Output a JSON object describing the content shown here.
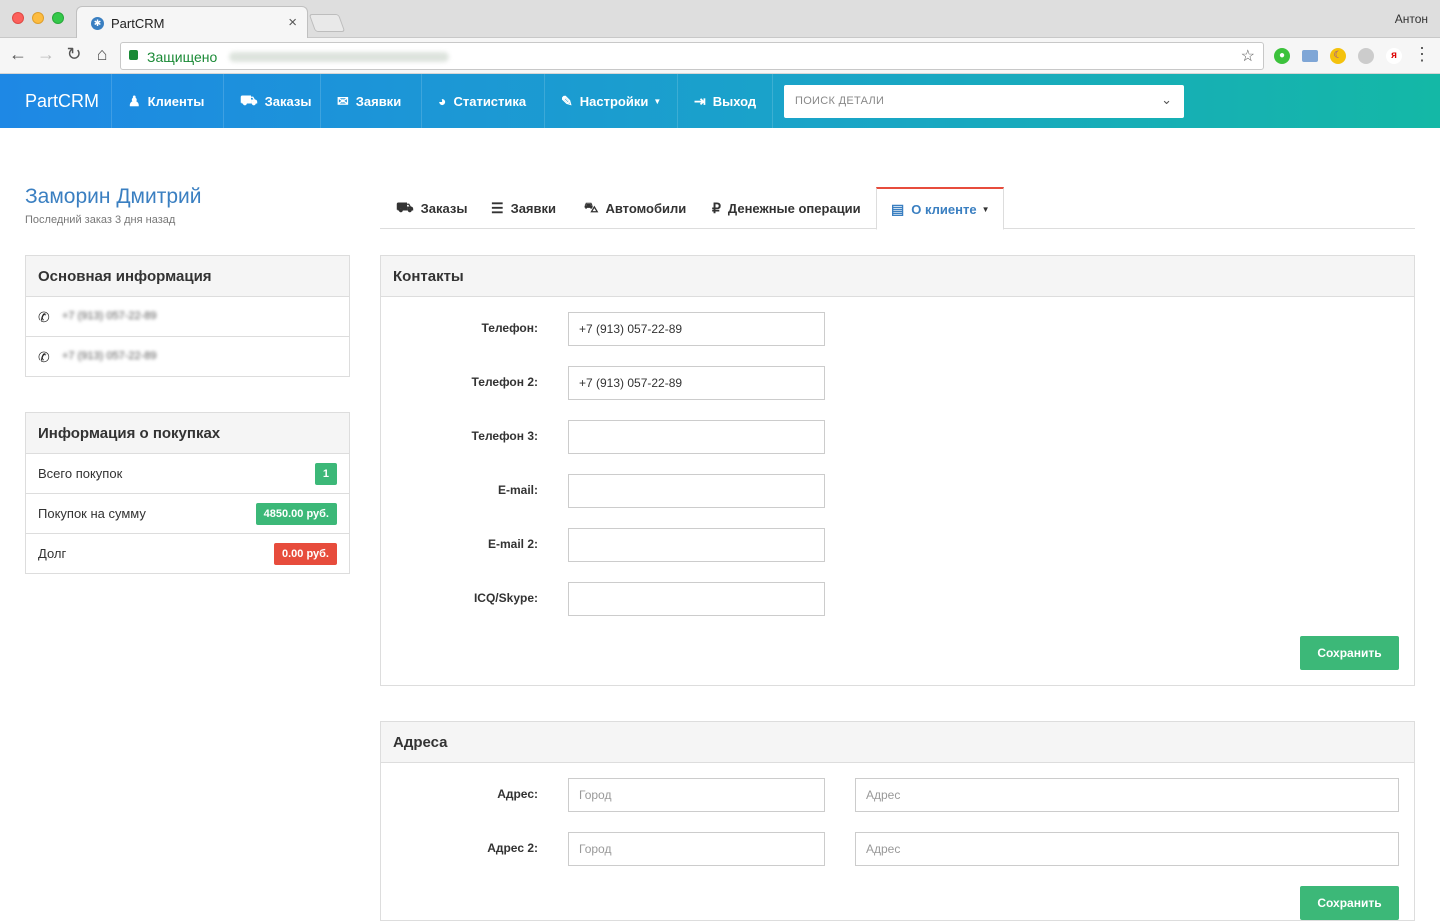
{
  "browser": {
    "tab_title": "PartCRM",
    "tab_close": "×",
    "profile_name": "Антон",
    "secure_label": "Защищено",
    "extension_ya": "я"
  },
  "nav": {
    "brand": "PartCRM",
    "items": [
      {
        "label": "Клиенты",
        "icon": "user-icon"
      },
      {
        "label": "Заказы",
        "icon": "cart-icon"
      },
      {
        "label": "Заявки",
        "icon": "comments-icon"
      },
      {
        "label": "Статистика",
        "icon": "pie-chart-icon"
      },
      {
        "label": "Настройки",
        "icon": "wrench-icon"
      },
      {
        "label": "Выход",
        "icon": "logout-icon"
      }
    ],
    "search_placeholder": "ПОИСК ДЕТАЛИ"
  },
  "client": {
    "name": "Заморин Дмитрий",
    "last_order": "Последний заказ 3 дня назад"
  },
  "basic_info": {
    "title": "Основная информация",
    "phones": [
      "+7 (913) 057-22-89",
      "+7 (913) 057-22-89"
    ]
  },
  "purchases": {
    "title": "Информация о покупках",
    "rows": [
      {
        "label": "Всего покупок",
        "value": "1",
        "color": "#3cb878"
      },
      {
        "label": "Покупок на сумму",
        "value": "4850.00 руб.",
        "color": "#3cb878"
      },
      {
        "label": "Долг",
        "value": "0.00 руб.",
        "color": "#e74c3c"
      }
    ]
  },
  "tabs": [
    {
      "label": "Заказы",
      "icon": "cart-icon"
    },
    {
      "label": "Заявки",
      "icon": "list-icon"
    },
    {
      "label": "Автомобили",
      "icon": "car-icon"
    },
    {
      "label": "Денежные операции",
      "icon": "ruble-icon"
    },
    {
      "label": "О клиенте",
      "icon": "contact-card-icon",
      "active": true
    }
  ],
  "contacts": {
    "title": "Контакты",
    "fields": [
      {
        "label": "Телефон:",
        "value": "+7 (913) 057-22-89"
      },
      {
        "label": "Телефон 2:",
        "value": "+7 (913) 057-22-89"
      },
      {
        "label": "Телефон 3:",
        "value": ""
      },
      {
        "label": "E-mail:",
        "value": ""
      },
      {
        "label": "E-mail 2:",
        "value": ""
      },
      {
        "label": "ICQ/Skype:",
        "value": ""
      }
    ],
    "save_label": "Сохранить"
  },
  "addresses": {
    "title": "Адреса",
    "rows": [
      {
        "label": "Адрес:",
        "city_placeholder": "Город",
        "address_placeholder": "Адрес"
      },
      {
        "label": "Адрес 2:",
        "city_placeholder": "Город",
        "address_placeholder": "Адрес"
      }
    ]
  },
  "colors": {
    "accent": "#3a7fc1",
    "success": "#3cb878",
    "danger": "#e74c3c",
    "navbar_start": "#1e88e5",
    "navbar_end": "#14b8a6"
  }
}
